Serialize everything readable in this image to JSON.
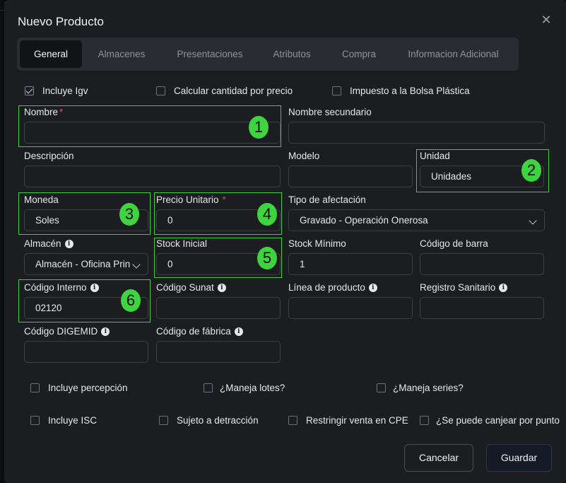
{
  "title": "Nuevo Producto",
  "tabs": [
    "General",
    "Almacenes",
    "Presentaciones",
    "Atributos",
    "Compra",
    "Informacion Adicional"
  ],
  "top_checks": [
    {
      "label": "Incluye Igv",
      "checked": true
    },
    {
      "label": "Calcular cantidad por precio",
      "checked": false
    },
    {
      "label": "Impuesto a la Bolsa Plástica",
      "checked": false
    }
  ],
  "fields": {
    "nombre": {
      "label": "Nombre",
      "value": ""
    },
    "nombre_secundario": {
      "label": "Nombre secundario",
      "value": ""
    },
    "descripcion": {
      "label": "Descripción",
      "value": ""
    },
    "modelo": {
      "label": "Modelo",
      "value": ""
    },
    "unidad": {
      "label": "Unidad",
      "value": "Unidades"
    },
    "moneda": {
      "label": "Moneda",
      "value": "Soles"
    },
    "precio_unitario": {
      "label": "Precio Unitario",
      "value": "0"
    },
    "tipo_afectacion": {
      "label": "Tipo de afectación",
      "value": "Gravado - Operación Onerosa"
    },
    "almacen": {
      "label": "Almacén",
      "value": "Almacén - Oficina Prin"
    },
    "stock_inicial": {
      "label": "Stock Inicial",
      "value": "0"
    },
    "stock_minimo": {
      "label": "Stock Mínimo",
      "value": "1"
    },
    "codigo_barra": {
      "label": "Código de barra",
      "value": ""
    },
    "codigo_interno": {
      "label": "Código Interno",
      "value": "02120"
    },
    "codigo_sunat": {
      "label": "Código Sunat",
      "value": ""
    },
    "linea_producto": {
      "label": "Línea de producto",
      "value": ""
    },
    "registro_sanitario": {
      "label": "Registro Sanitario",
      "value": ""
    },
    "codigo_digemid": {
      "label": "Código DIGEMID",
      "value": ""
    },
    "codigo_fabrica": {
      "label": "Código de fábrica",
      "value": ""
    }
  },
  "required_mark": "*",
  "bottom_checks": [
    {
      "label": "Incluye percepción",
      "checked": false
    },
    {
      "label": "¿Maneja lotes?",
      "checked": false
    },
    {
      "label": "¿Maneja series?",
      "checked": false
    },
    {
      "label": "Incluye ISC",
      "checked": false
    },
    {
      "label": "Sujeto a detracción",
      "checked": false
    },
    {
      "label": "Restringir venta en CPE",
      "checked": false
    },
    {
      "label": "¿Se puede canjear por punto",
      "checked": false
    }
  ],
  "annotations": [
    "1",
    "2",
    "3",
    "4",
    "5",
    "6"
  ],
  "icons": {
    "close": "close-icon",
    "info": "info-icon",
    "chevron": "chevron-down-icon"
  },
  "buttons": {
    "cancel": "Cancelar",
    "save": "Guardar"
  },
  "highlight_color": "#3dcc3d"
}
